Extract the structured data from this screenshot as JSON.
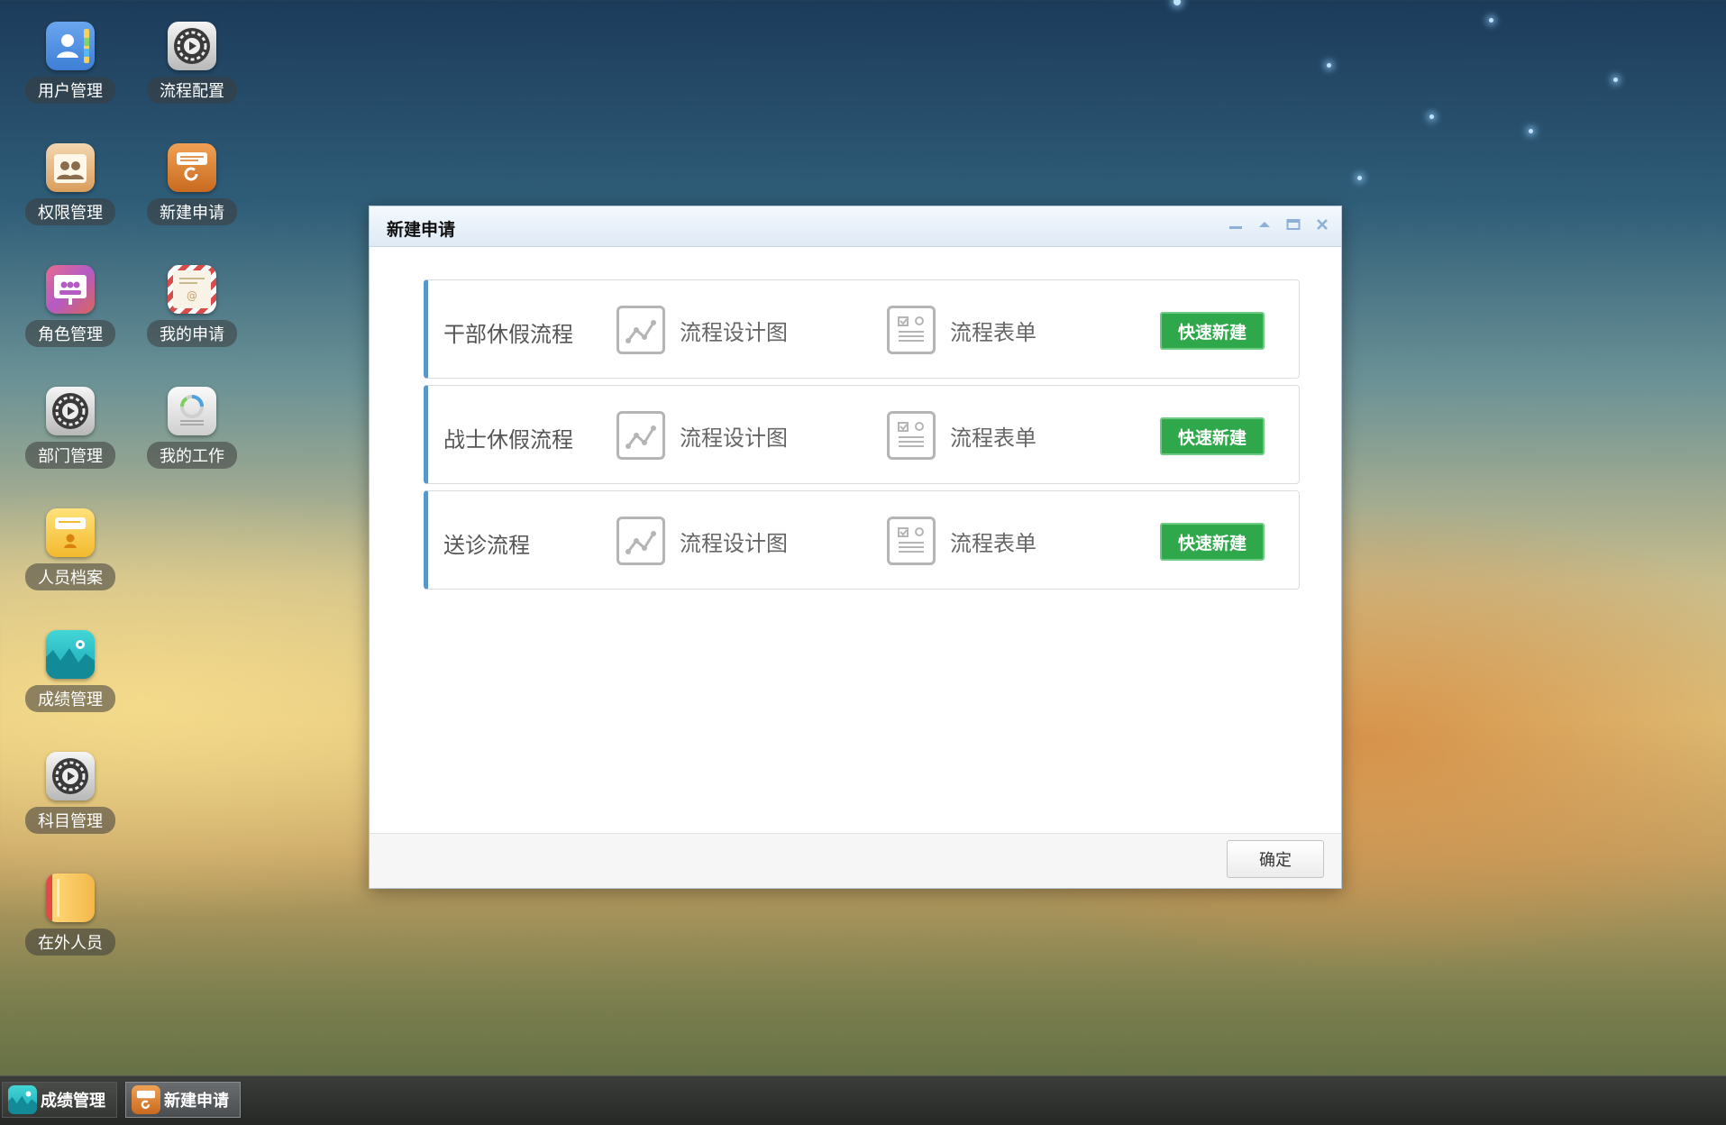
{
  "desktop": {
    "icons": [
      {
        "label": "用户管理",
        "icon": "contacts-icon"
      },
      {
        "label": "流程配置",
        "icon": "gear-icon"
      },
      {
        "label": "权限管理",
        "icon": "users-group-icon"
      },
      {
        "label": "新建申请",
        "icon": "form-refresh-icon"
      },
      {
        "label": "角色管理",
        "icon": "presentation-icon"
      },
      {
        "label": "我的申请",
        "icon": "mail-icon"
      },
      {
        "label": "部门管理",
        "icon": "gear-icon"
      },
      {
        "label": "我的工作",
        "icon": "progress-icon"
      },
      {
        "label": "人员档案",
        "icon": "person-card-icon"
      },
      {
        "label": "成绩管理",
        "icon": "wave-chart-icon"
      },
      {
        "label": "科目管理",
        "icon": "gear-icon"
      },
      {
        "label": "在外人员",
        "icon": "notebook-icon"
      }
    ]
  },
  "dialog": {
    "title": "新建申请",
    "controls": [
      "minimize-icon",
      "collapse-icon",
      "maximize-icon",
      "close-icon"
    ],
    "flows": [
      {
        "name": "干部休假流程",
        "design_label": "流程设计图",
        "form_label": "流程表单",
        "quick_label": "快速新建"
      },
      {
        "name": "战士休假流程",
        "design_label": "流程设计图",
        "form_label": "流程表单",
        "quick_label": "快速新建"
      },
      {
        "name": "送诊流程",
        "design_label": "流程设计图",
        "form_label": "流程表单",
        "quick_label": "快速新建"
      }
    ],
    "ok_label": "确定"
  },
  "taskbar": {
    "items": [
      {
        "label": "成绩管理",
        "icon": "wave-chart-icon",
        "active": false
      },
      {
        "label": "新建申请",
        "icon": "form-refresh-icon",
        "active": true
      }
    ]
  },
  "colors": {
    "accent_green": "#2ea84a",
    "row_accent_blue": "#5b96c8"
  }
}
